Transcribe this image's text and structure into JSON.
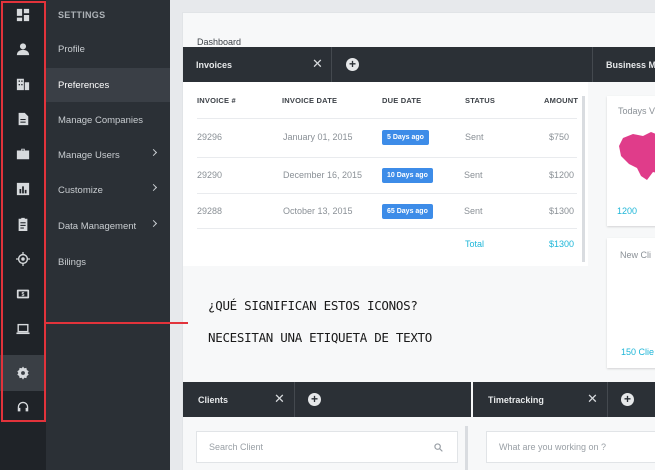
{
  "rail": {
    "icons": [
      "dashboard-icon",
      "user-icon",
      "building-icon",
      "document-icon",
      "briefcase-icon",
      "chart-icon",
      "clipboard-icon",
      "target-icon",
      "money-icon",
      "laptop-icon",
      "gear-icon",
      "headset-icon"
    ],
    "active": "gear-icon",
    "outline_color": "#e2333b"
  },
  "sidebar": {
    "title": "SETTINGS",
    "items": [
      {
        "label": "Profile"
      },
      {
        "label": "Preferences"
      },
      {
        "label": "Manage Companies"
      },
      {
        "label": "Manage Users"
      },
      {
        "label": "Customize"
      },
      {
        "label": "Data Management"
      },
      {
        "label": "Bilings"
      }
    ]
  },
  "dashboard": {
    "title": "Dashboard",
    "invoices": {
      "tab": "Invoices",
      "headers": [
        "INVOICE #",
        "INVOICE DATE",
        "DUE DATE",
        "STATUS",
        "AMOUNT"
      ],
      "rows": [
        {
          "num": "29296",
          "date": "January 01, 2015",
          "due": "5 Days ago",
          "status": "Sent",
          "amount": "$750"
        },
        {
          "num": "29290",
          "date": "December 16, 2015",
          "due": "10 Days ago",
          "status": "Sent",
          "amount": "$1200"
        },
        {
          "num": "29288",
          "date": "October 13, 2015",
          "due": "65 Days ago",
          "status": "Sent",
          "amount": "$1300"
        }
      ],
      "total_label": "Total",
      "total_value": "$1300"
    },
    "business": {
      "tab": "Business M",
      "card1_label": "Todays V",
      "card1_value": "1200",
      "card2_label": "New Cli",
      "card2_value": "150 Clie"
    },
    "clients": {
      "tab": "Clients",
      "search_placeholder": "Search Client"
    },
    "timetracking": {
      "tab": "Timetracking",
      "input_placeholder": "What are you working on ?"
    }
  },
  "annotation": {
    "line1": "¿QUÉ SIGNIFICAN ESTOS ICONOS?",
    "line2": "NECESITAN UNA ETIQUETA DE TEXTO"
  },
  "colors": {
    "accent": "#1eb6d8",
    "badge": "#3d8ce8",
    "dark": "#2b3036",
    "outline": "#e2333b"
  }
}
